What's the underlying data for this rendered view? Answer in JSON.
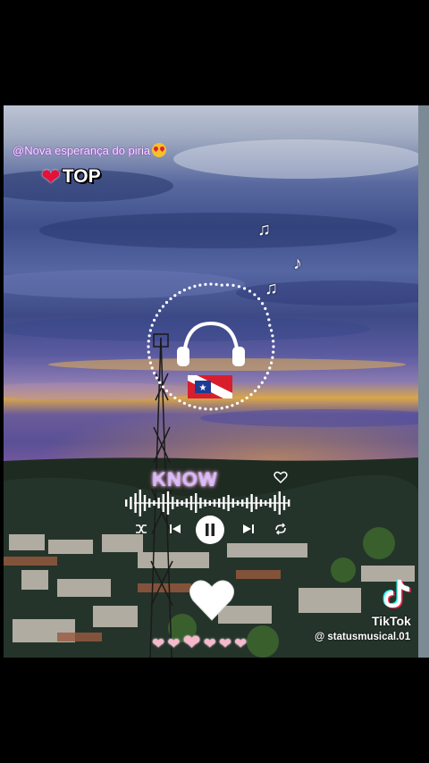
{
  "overlay": {
    "caption": "@Nova esperança do piria",
    "caption_emoji": "heart-eyes-emoji",
    "badge_heart": "❤",
    "badge_label": "TOP"
  },
  "player": {
    "song_title": "KNOW",
    "accent_color": "#d6b8ff",
    "controls": [
      "shuffle-icon",
      "previous-icon",
      "pause-icon",
      "next-icon",
      "repeat-icon"
    ],
    "like_icon": "heart-outline-icon"
  },
  "decor": {
    "notes": [
      "♫",
      "♪",
      "♫",
      "♪"
    ],
    "hearts": [
      "❤",
      "❤",
      "❤",
      "❤",
      "❤",
      "❤"
    ]
  },
  "watermark": {
    "brand": "TikTok",
    "handle": "@ statusmusical.01"
  }
}
